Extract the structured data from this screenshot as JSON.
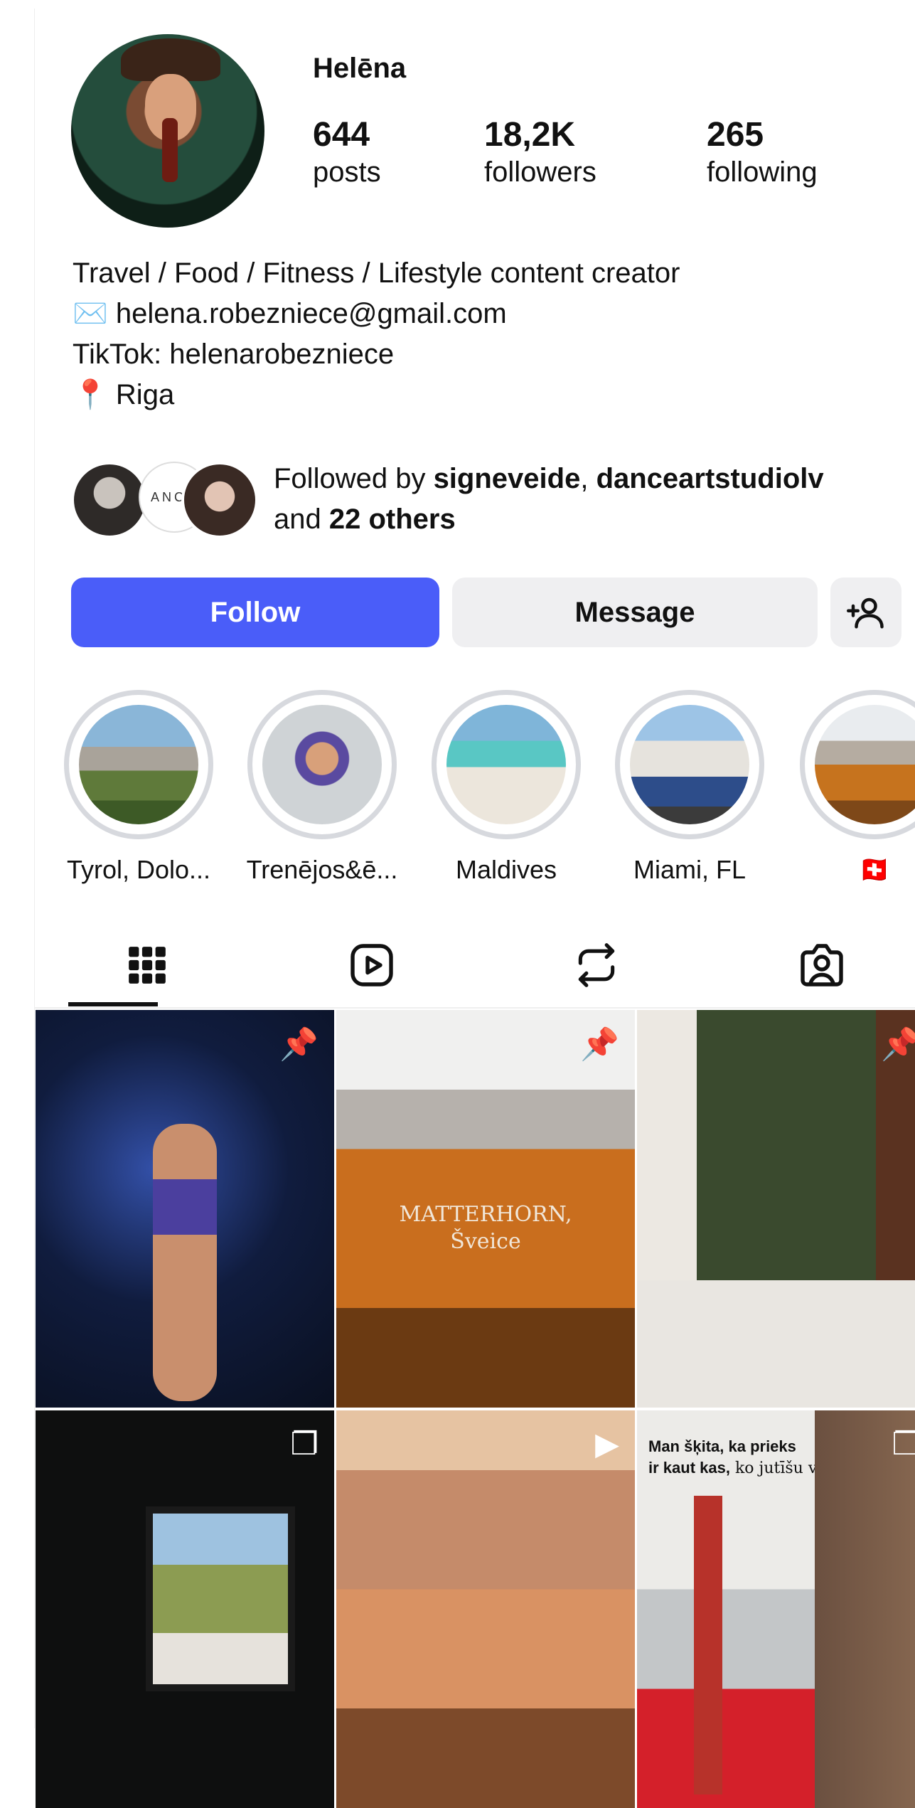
{
  "profile": {
    "name": "Helēna",
    "stats": [
      {
        "value": "644",
        "label": "posts"
      },
      {
        "value": "18,2K",
        "label": "followers"
      },
      {
        "value": "265",
        "label": "following"
      }
    ],
    "bio": [
      "Travel / Food / Fitness / Lifestyle content creator",
      "✉️ helena.robezniece@gmail.com",
      "TikTok: helenarobezniece",
      "📍 Riga"
    ],
    "followed_by": {
      "prefix": "Followed by ",
      "user1": "signeveide",
      "sep": ", ",
      "user2": "danceartstudiolv",
      "and": "and ",
      "others": "22 others",
      "mini_logo_text": "ANCE"
    }
  },
  "buttons": {
    "follow": "Follow",
    "message": "Message",
    "add_person_icon": "person-add-icon"
  },
  "highlights": [
    {
      "label": "Tyrol, Dolo..."
    },
    {
      "label": "Trenējos&ē..."
    },
    {
      "label": "Maldives"
    },
    {
      "label": "Miami, FL"
    },
    {
      "label": "🇨🇭"
    }
  ],
  "tabs": [
    "grid-icon",
    "reels-icon",
    "reposts-icon",
    "tagged-icon"
  ],
  "posts": [
    {
      "icon": "pin-icon"
    },
    {
      "icon": "pin-icon",
      "overlay_title": "MATTERHORN,",
      "overlay_subtitle": "Šveice"
    },
    {
      "icon": "pin-icon"
    },
    {
      "icon": "carousel-icon"
    },
    {
      "icon": "reel-icon"
    },
    {
      "icon": "carousel-icon",
      "overlay_bold": "Man šķita, ka prieks",
      "overlay_bold2": "ir kaut kas,",
      "overlay_normal": " ko jutīšu vēlāk."
    }
  ],
  "colors": {
    "accent": "#4a5df9",
    "button_bg": "#efeff1",
    "ring": "#d7d9de"
  }
}
